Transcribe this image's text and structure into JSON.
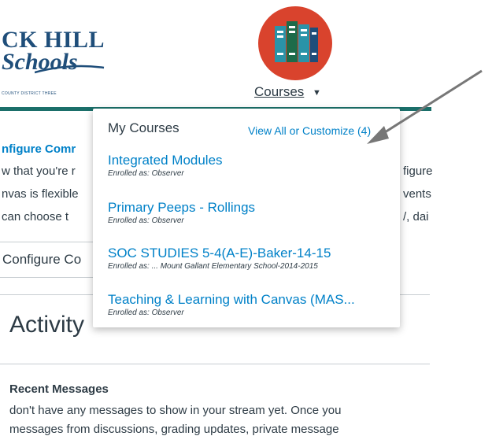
{
  "logo": {
    "line1": "CK HILL",
    "line2": "Schools",
    "line3": "COUNTY DISTRICT THREE"
  },
  "nav": {
    "courses_label": "Courses",
    "courses_icon": "books-icon",
    "courses_icon_color": "#d9432d",
    "teal_color": "#1b6f6a"
  },
  "background": {
    "configure_link": "nfigure Comr",
    "line1": "w that you're r",
    "line1_right": "figure",
    "line2": "nvas is flexible",
    "line2_right": "vents",
    "line3": " can choose t",
    "line3_right": "/, dai",
    "configure_button": "Configure Co",
    "activity_heading": "Activity",
    "recent_messages": "Recent Messages",
    "msg_line1": "don't have any messages to show in your stream yet. Once you",
    "msg_line2": "messages from discussions, grading updates, private message"
  },
  "dropdown": {
    "title": "My Courses",
    "view_all": "View All or Customize (4)",
    "courses": [
      {
        "name": "Integrated Modules",
        "role": "Enrolled as: Observer"
      },
      {
        "name": "Primary Peeps - Rollings",
        "role": "Enrolled as: Observer"
      },
      {
        "name": "SOC STUDIES 5-4(A-E)-Baker-14-15",
        "role": "Enrolled as: ...  Mount Gallant Elementary School-2014-2015"
      },
      {
        "name": "Teaching & Learning with Canvas (MAS...",
        "role": "Enrolled as: Observer"
      }
    ]
  }
}
